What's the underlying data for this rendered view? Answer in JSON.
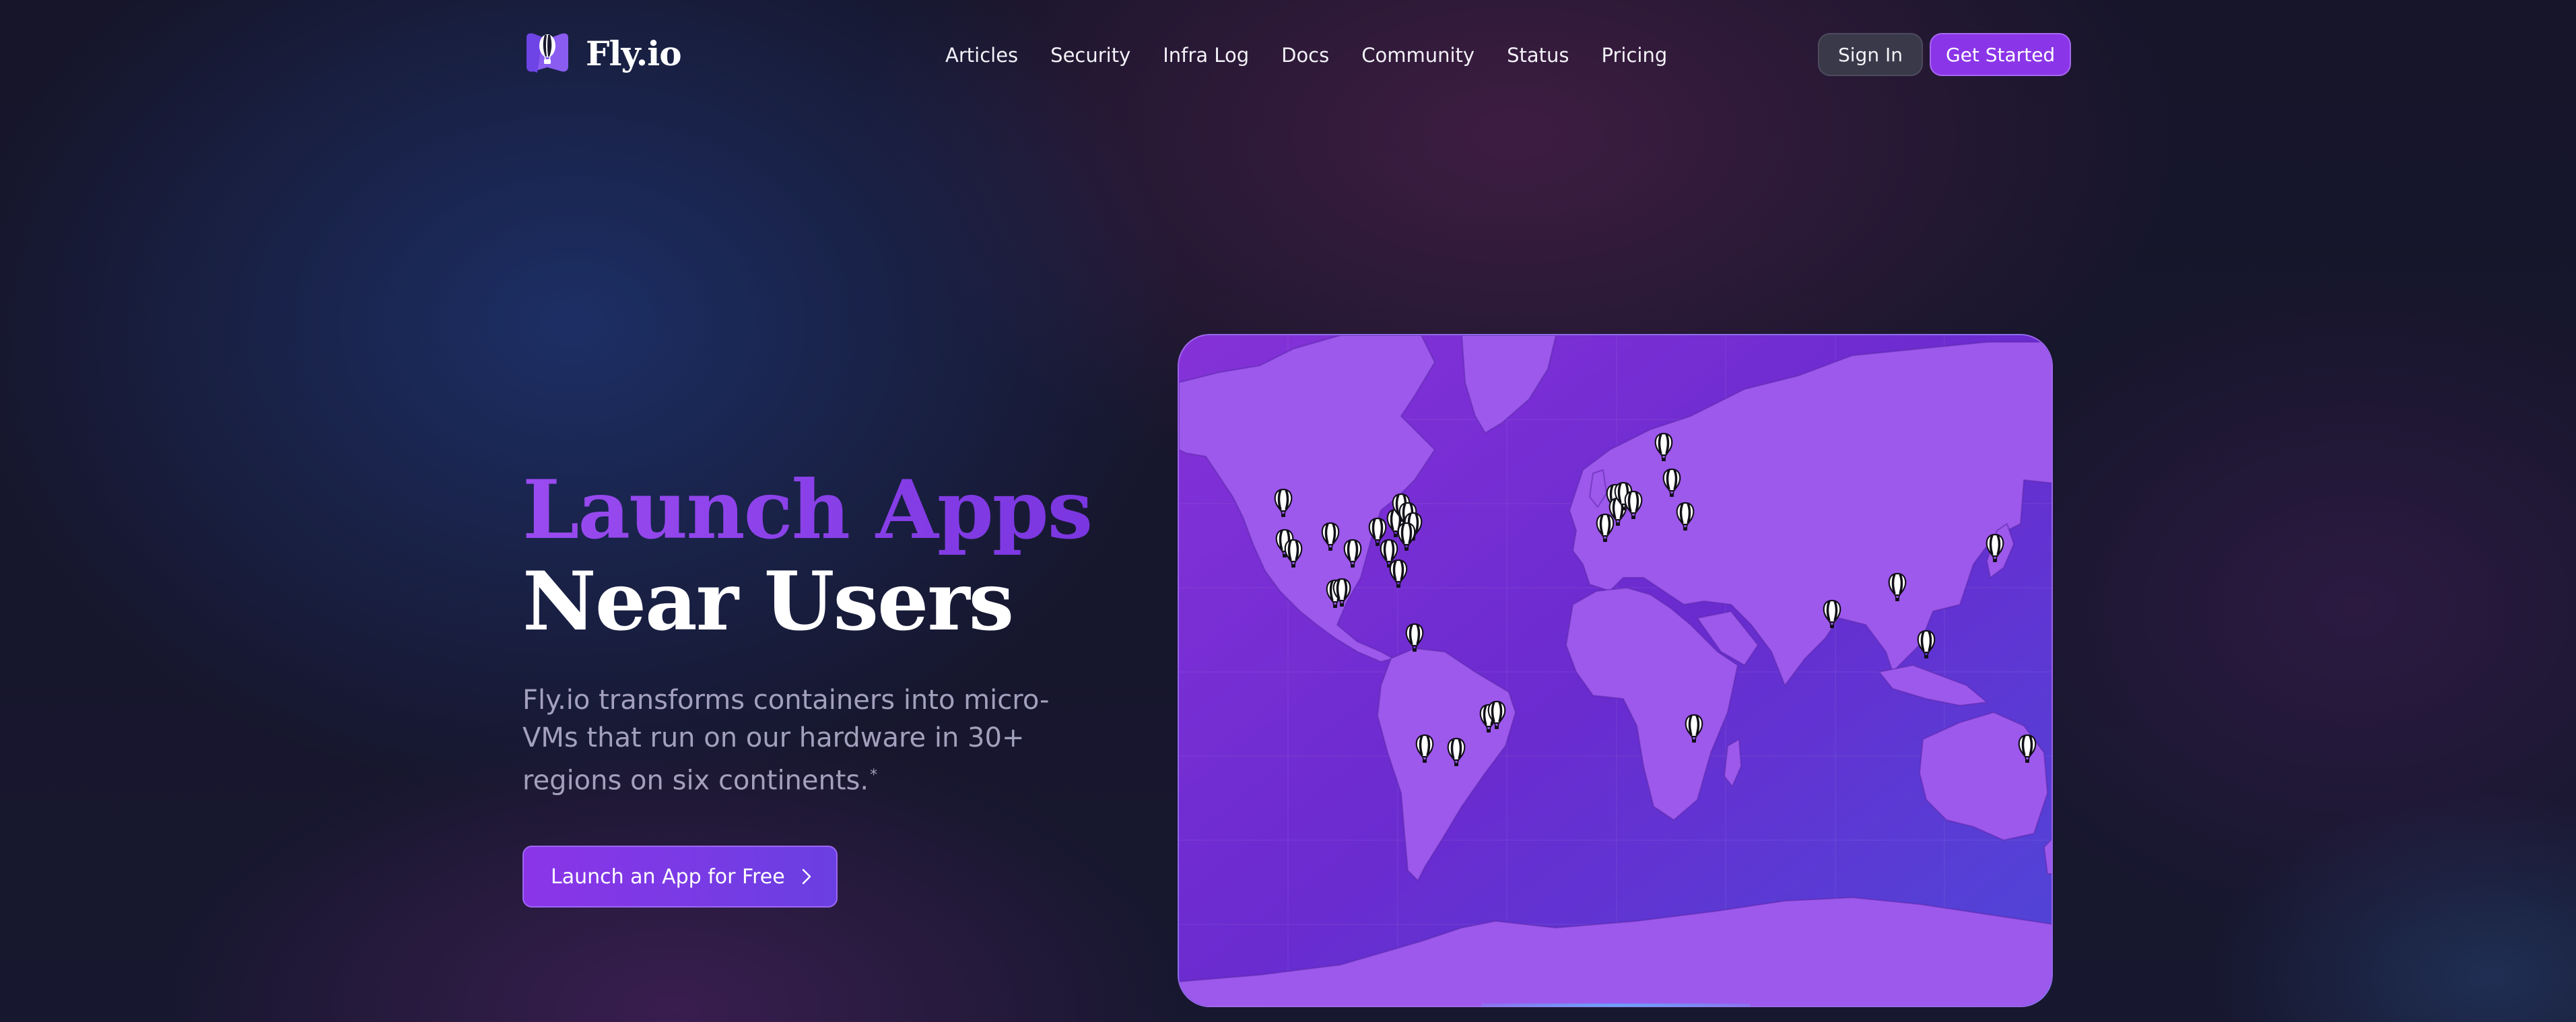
{
  "nav": {
    "logo_text": "Fly.io",
    "links": [
      "Articles",
      "Security",
      "Infra Log",
      "Docs",
      "Community",
      "Status",
      "Pricing"
    ],
    "sign_in": "Sign In",
    "get_started": "Get Started"
  },
  "hero": {
    "title_line1": "Launch Apps",
    "title_line2": "Near Users",
    "description": "Fly.io transforms containers into micro-VMs that run on our hardware in 30+ regions on six continents.",
    "footnote_mark": "*",
    "cta_label": "Launch an App for Free"
  },
  "map": {
    "marker_icon": "hot-air-balloon-icon",
    "land_color": "#9b55ec",
    "ocean_color": "#6b2ad0"
  },
  "colors": {
    "accent": "#8b35e8",
    "background": "#16152a"
  }
}
